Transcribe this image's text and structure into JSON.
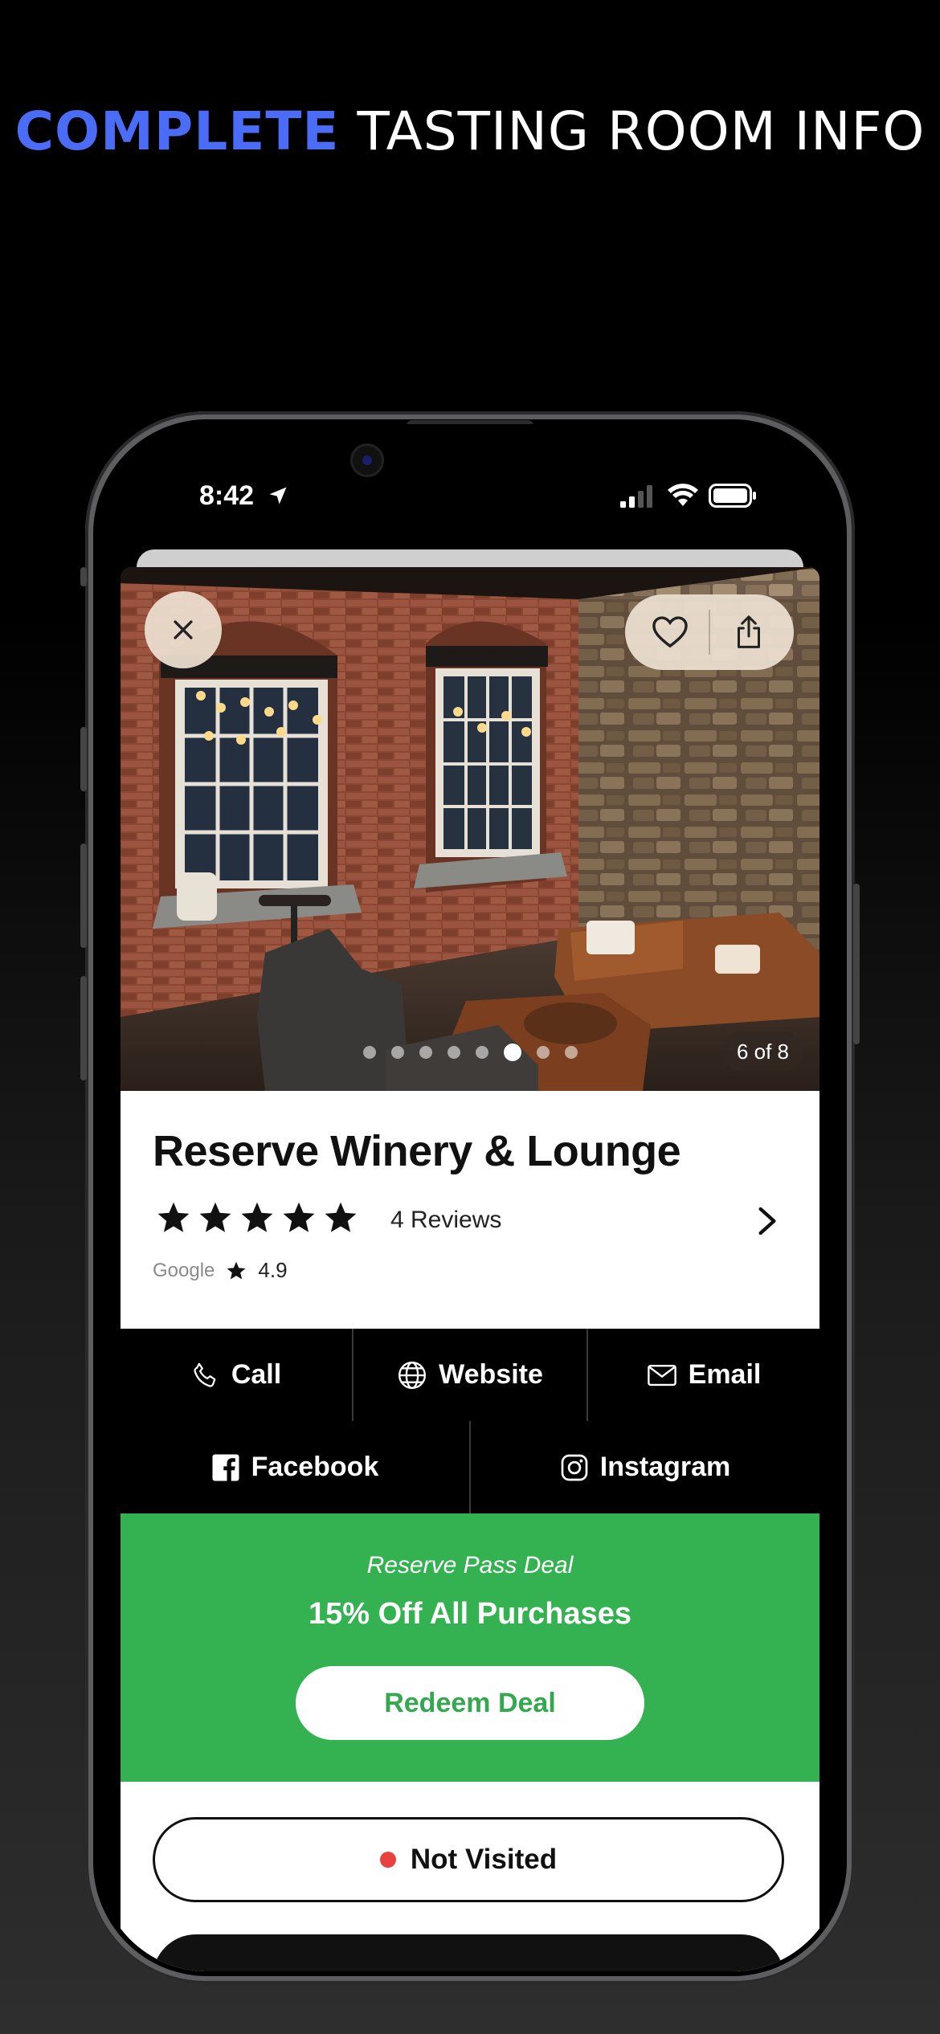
{
  "headline": {
    "accent": "COMPLETE",
    "rest": "TASTING ROOM INFO"
  },
  "status_bar": {
    "time": "8:42"
  },
  "photo": {
    "counter": "6 of 8",
    "total_images": 8,
    "current_index": 6
  },
  "venue": {
    "name": "Reserve Winery & Lounge",
    "stars": 5,
    "reviews_label": "4 Reviews",
    "google_label": "Google",
    "google_rating": "4.9"
  },
  "actions": {
    "call": "Call",
    "website": "Website",
    "email": "Email",
    "facebook": "Facebook",
    "instagram": "Instagram"
  },
  "deal": {
    "subtitle": "Reserve Pass Deal",
    "title": "15% Off All Purchases",
    "button": "Redeem Deal",
    "background": "#34b150"
  },
  "visit_status": {
    "label": "Not Visited",
    "dot_color": "#e8413e"
  },
  "colors": {
    "accent": "#4a6cf7"
  },
  "icons": [
    "close-icon",
    "heart-icon",
    "share-icon",
    "star-icon",
    "chevron-right-icon",
    "phone-icon",
    "globe-icon",
    "mail-icon",
    "facebook-icon",
    "instagram-icon",
    "location-arrow-icon",
    "signal-icon",
    "wifi-icon",
    "battery-icon"
  ]
}
